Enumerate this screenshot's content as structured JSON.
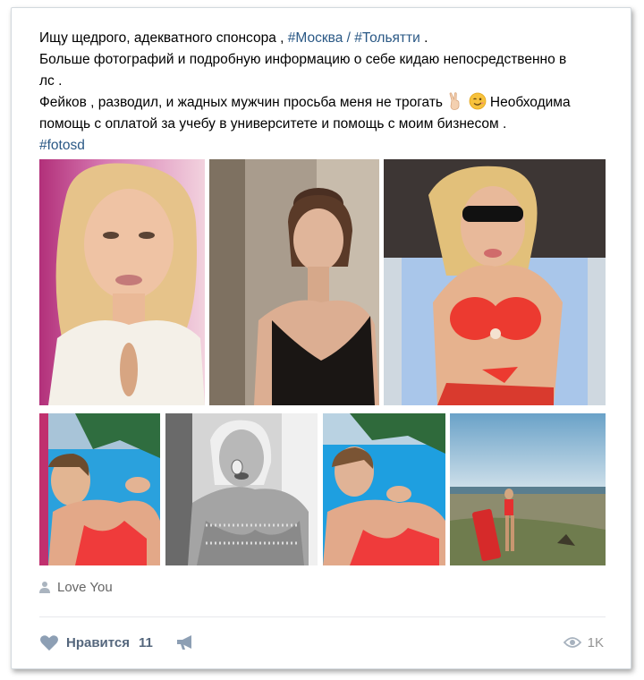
{
  "post": {
    "line1_text": "Ищу щедрого, адекватного спонсора , ",
    "tag_moscow": "#Москва",
    "line1_sep": " / ",
    "tag_togliatti": "#Тольятти",
    "line1_end": " .",
    "line2": "Больше фотографий и подробную информацию о себе кидаю непосредственно в",
    "line3": "лс .",
    "line4_text": "Фейков , разводил, и жадных мужчин просьба меня не трогать ",
    "line4_end": " Необходима",
    "line5": "помощь с оплатой за учебу в университете и помощь с моим бизнесом .",
    "tag_fotosd": "#fotosd",
    "emoji_icons": [
      "victory-hand-icon",
      "winking-face-icon"
    ]
  },
  "photos": [
    {
      "name": "photo-1",
      "desc": "selfie white top"
    },
    {
      "name": "photo-2",
      "desc": "black lace top"
    },
    {
      "name": "photo-3",
      "desc": "red bikini sunglasses"
    },
    {
      "name": "photo-4",
      "desc": "pool selfie"
    },
    {
      "name": "photo-5",
      "desc": "sequin dress bw"
    },
    {
      "name": "photo-6",
      "desc": "pool selfie 2"
    },
    {
      "name": "photo-7",
      "desc": "beach landscape"
    }
  ],
  "author": {
    "name": "Love You",
    "icon": "user-icon"
  },
  "footer": {
    "like_label": "Нравится",
    "like_count": "11",
    "views": "1K",
    "icons": [
      "heart-icon",
      "megaphone-icon",
      "eye-icon"
    ]
  },
  "colors": {
    "link": "#2a5885",
    "footer_text": "#55677d",
    "muted": "#939393",
    "border": "#d3d9de"
  }
}
